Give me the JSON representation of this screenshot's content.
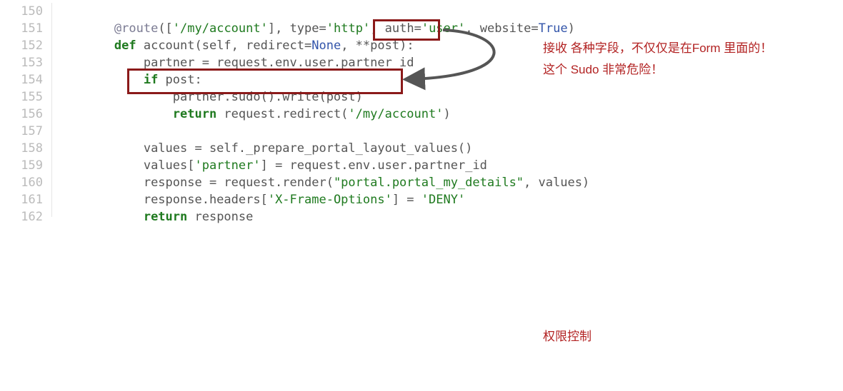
{
  "lines": [
    {
      "n": "150",
      "indent": ""
    },
    {
      "n": "151",
      "indent": "        "
    },
    {
      "n": "152",
      "indent": "        "
    },
    {
      "n": "153",
      "indent": "            "
    },
    {
      "n": "154",
      "indent": "            "
    },
    {
      "n": "155",
      "indent": "                "
    },
    {
      "n": "156",
      "indent": "                "
    },
    {
      "n": "157",
      "indent": ""
    },
    {
      "n": "158",
      "indent": "            "
    },
    {
      "n": "159",
      "indent": "            "
    },
    {
      "n": "160",
      "indent": "            "
    },
    {
      "n": "161",
      "indent": "            "
    },
    {
      "n": "162",
      "indent": "            "
    }
  ],
  "code": {
    "l151": {
      "decorator": "@route",
      "open": "([",
      "str1": "'/my/account'",
      "mid1": "], type=",
      "str2": "'http'",
      "mid2": ", auth=",
      "str3": "'user'",
      "mid3": ", website=",
      "true": "True",
      "close": ")"
    },
    "l152": {
      "def": "def",
      "name": " account(self, redirect=",
      "none": "None",
      "rest": ", **post):"
    },
    "l153": {
      "text": "partner = request.env.user.partner_id"
    },
    "l154": {
      "if": "if",
      "rest": " post:"
    },
    "l155": {
      "text": "partner.sudo().write(post)"
    },
    "l156": {
      "ret": "return",
      "mid": " request.redirect(",
      "str": "'/my/account'",
      "close": ")"
    },
    "l158": {
      "text": "values = self._prepare_portal_layout_values()"
    },
    "l159": {
      "a": "values[",
      "str": "'partner'",
      "b": "] = request.env.user.partner_id"
    },
    "l160": {
      "a": "response = request.render(",
      "str": "\"portal.portal_my_details\"",
      "b": ", values)"
    },
    "l161": {
      "a": "response.headers[",
      "str1": "'X-Frame-Options'",
      "b": "] = ",
      "str2": "'DENY'"
    },
    "l162": {
      "ret": "return",
      "rest": " response"
    }
  },
  "annotations": {
    "a1": "接收 各种字段，不仅仅是在Form 里面的！",
    "a2": "这个 Sudo 非常危险！",
    "a3": "权限控制"
  }
}
